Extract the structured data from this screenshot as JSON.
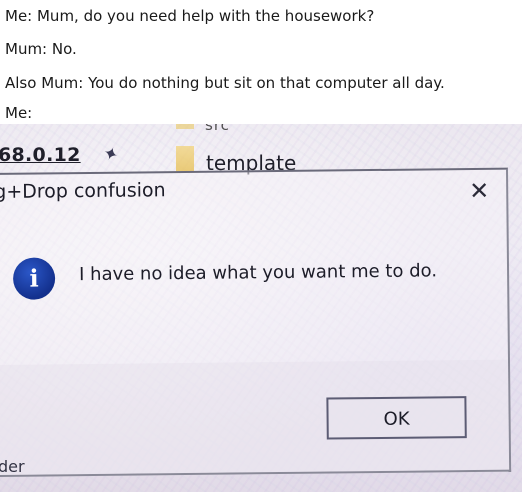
{
  "caption": {
    "line1": "Me: Mum, do you need help with the housework?",
    "line2": "Mum: No.",
    "line3": "Also Mum: You do nothing but sit on that computer all day.",
    "line4": "Me:"
  },
  "photo": {
    "background_strip": {
      "top_partial": "src",
      "ip_fragment": "68.0.12",
      "folder_label": "template"
    },
    "dialog": {
      "title": "g+Drop confusion",
      "close_glyph": "✕",
      "icon_glyph": "i",
      "message": "I have no idea what you want me to do.",
      "ok_label": "OK"
    },
    "bottom_partial": "der"
  },
  "colors": {
    "info_icon": "#1a3aa8",
    "text": "#1c1c28",
    "border": "#5c5c74"
  },
  "icons": {
    "pin": "pin-icon",
    "folder": "folder-icon",
    "close": "close-icon",
    "info": "info-icon"
  }
}
